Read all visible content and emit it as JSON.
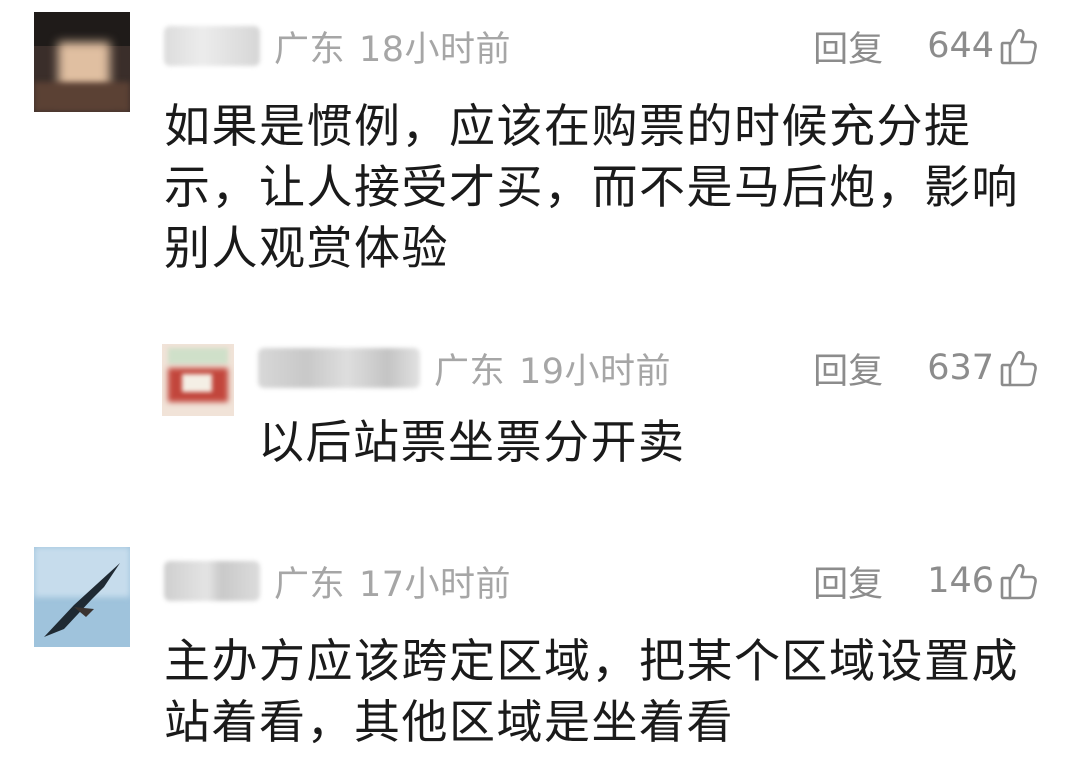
{
  "comments": [
    {
      "location": "广东",
      "time": "18小时前",
      "reply_label": "回复",
      "likes": "644",
      "avatar_icon": "user-avatar-icon",
      "text_lines": [
        "如果是惯例，应该在购票的时候充分提",
        "示，让人接受才买，而不是马后炮，影响",
        "别人观赏体验"
      ]
    },
    {
      "location": "广东",
      "time": "19小时前",
      "reply_label": "回复",
      "likes": "637",
      "avatar_icon": "user-avatar-icon",
      "text_lines": [
        "以后站票坐票分开卖"
      ]
    },
    {
      "location": "广东",
      "time": "17小时前",
      "reply_label": "回复",
      "likes": "146",
      "avatar_icon": "user-avatar-icon",
      "text_lines": [
        "主办方应该跨定区域，把某个区域设置成",
        "站着看，其他区域是坐着看"
      ]
    }
  ],
  "icons": {
    "like": "thumbs-up-icon"
  },
  "colors": {
    "meta_text": "#a6a6a6",
    "action_text": "#8c8c8c",
    "body_text": "#1a1a1a"
  }
}
